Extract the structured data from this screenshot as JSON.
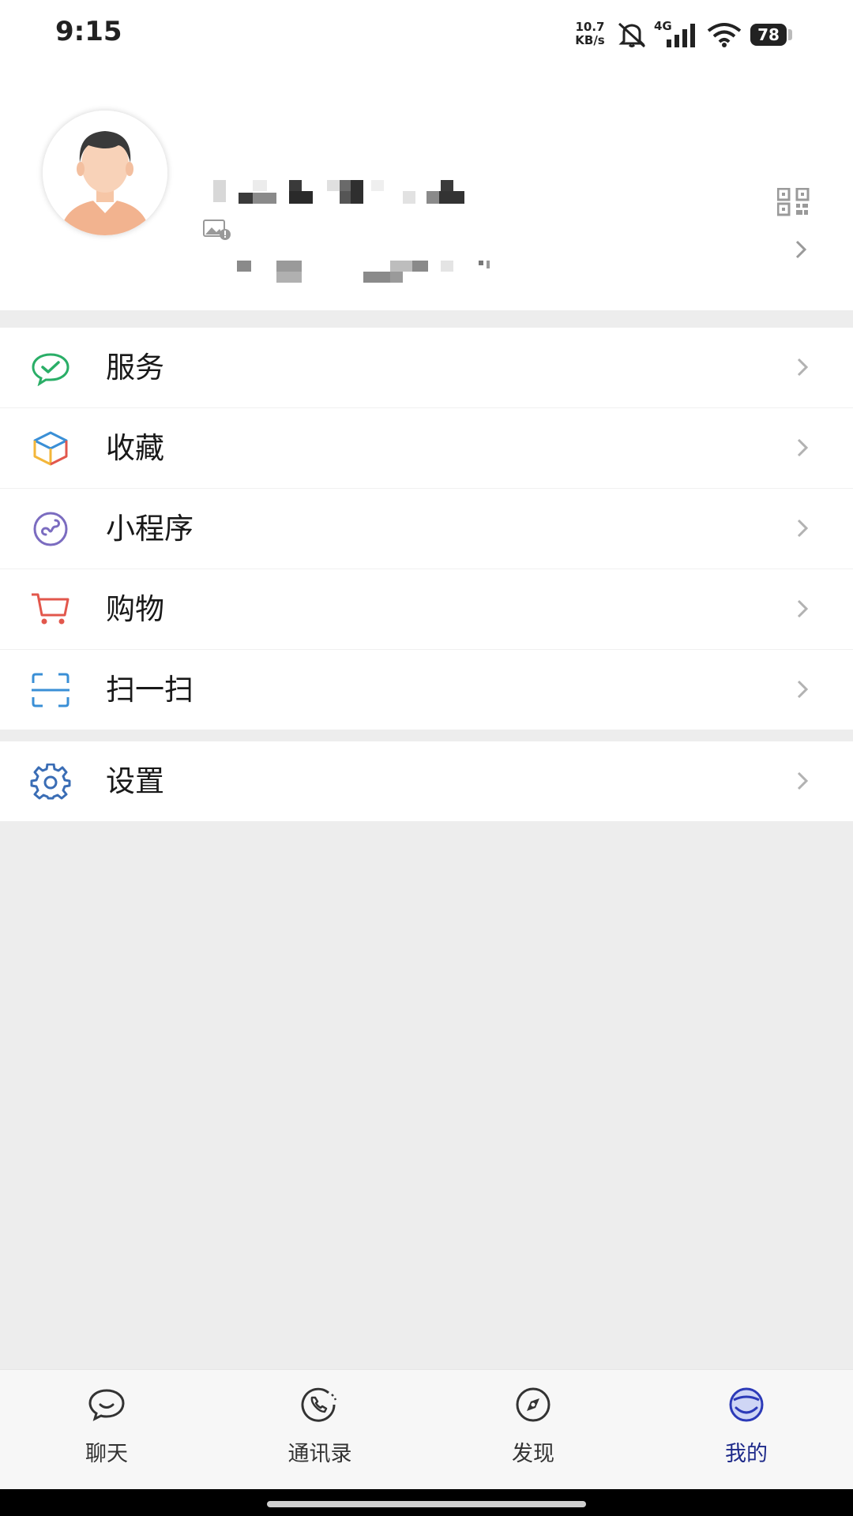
{
  "status_bar": {
    "time": "9:15",
    "network_speed_value": "10.7",
    "network_speed_unit": "KB/s",
    "network_type": "4G",
    "battery": "78",
    "icons": [
      "mute-icon",
      "signal-icon",
      "wifi-icon",
      "battery-icon"
    ]
  },
  "profile": {
    "avatar_icon": "avatar-male-icon",
    "status_icon": "image-status-icon",
    "qr_icon": "qr-code-icon",
    "chevron_icon": "chevron-right-icon"
  },
  "menu": {
    "group1": [
      {
        "label": "服务",
        "icon": "service-wechat-pay-icon",
        "color": "#2aae67"
      },
      {
        "label": "收藏",
        "icon": "favorites-cube-icon",
        "color": "#f3b63a"
      },
      {
        "label": "小程序",
        "icon": "mini-program-icon",
        "color": "#7b6cc0"
      },
      {
        "label": "购物",
        "icon": "shopping-cart-icon",
        "color": "#e2574c"
      },
      {
        "label": "扫一扫",
        "icon": "scan-icon",
        "color": "#3a8fd6"
      }
    ],
    "group2": [
      {
        "label": "设置",
        "icon": "gear-icon",
        "color": "#3a6db5"
      }
    ]
  },
  "tabbar": {
    "items": [
      {
        "label": "聊天",
        "icon": "chat-bubble-icon"
      },
      {
        "label": "通讯录",
        "icon": "contacts-phone-icon"
      },
      {
        "label": "发现",
        "icon": "compass-icon"
      },
      {
        "label": "我的",
        "icon": "me-smile-icon",
        "active": true
      }
    ],
    "active_color": "#1e2a8a"
  }
}
